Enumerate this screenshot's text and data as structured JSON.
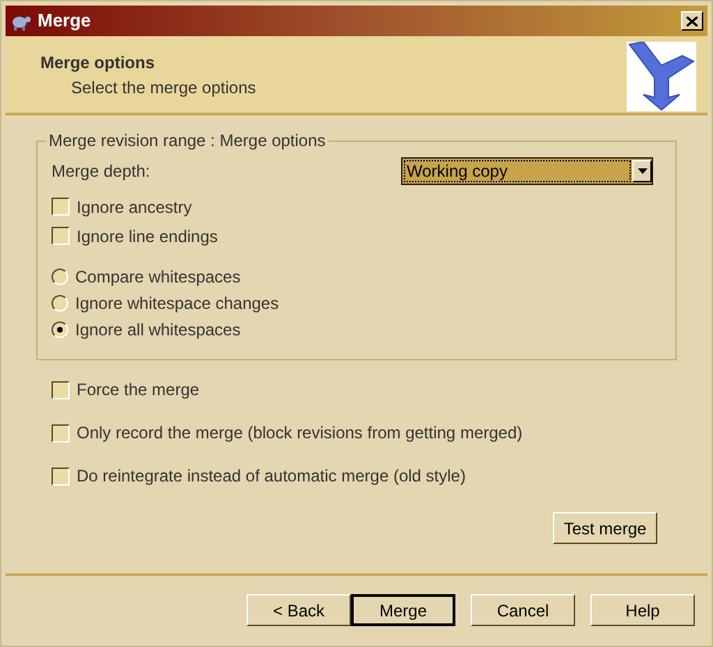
{
  "window": {
    "title": "Merge"
  },
  "header": {
    "title": "Merge options",
    "subtitle": "Select the merge options"
  },
  "group": {
    "title": "Merge revision range : Merge options",
    "depth_label": "Merge depth:",
    "depth_value": "Working copy",
    "options": [
      {
        "kind": "checkbox",
        "label": "Ignore ancestry",
        "checked": false
      },
      {
        "kind": "checkbox",
        "label": "Ignore line endings",
        "checked": false
      },
      {
        "kind": "radio",
        "label": "Compare whitespaces",
        "selected": false
      },
      {
        "kind": "radio",
        "label": "Ignore whitespace changes",
        "selected": false
      },
      {
        "kind": "radio",
        "label": "Ignore all whitespaces",
        "selected": true
      }
    ]
  },
  "options": [
    {
      "label": "Force the merge",
      "checked": false
    },
    {
      "label": "Only record the merge (block revisions from getting merged)",
      "checked": false
    },
    {
      "label": "Do reintegrate instead of automatic merge (old style)",
      "checked": false
    }
  ],
  "test_button": "Test merge",
  "buttons": [
    {
      "label": "< Back",
      "default": false
    },
    {
      "label": "Merge",
      "default": true
    },
    {
      "label": "Cancel",
      "default": false
    },
    {
      "label": "Help",
      "default": false
    }
  ]
}
